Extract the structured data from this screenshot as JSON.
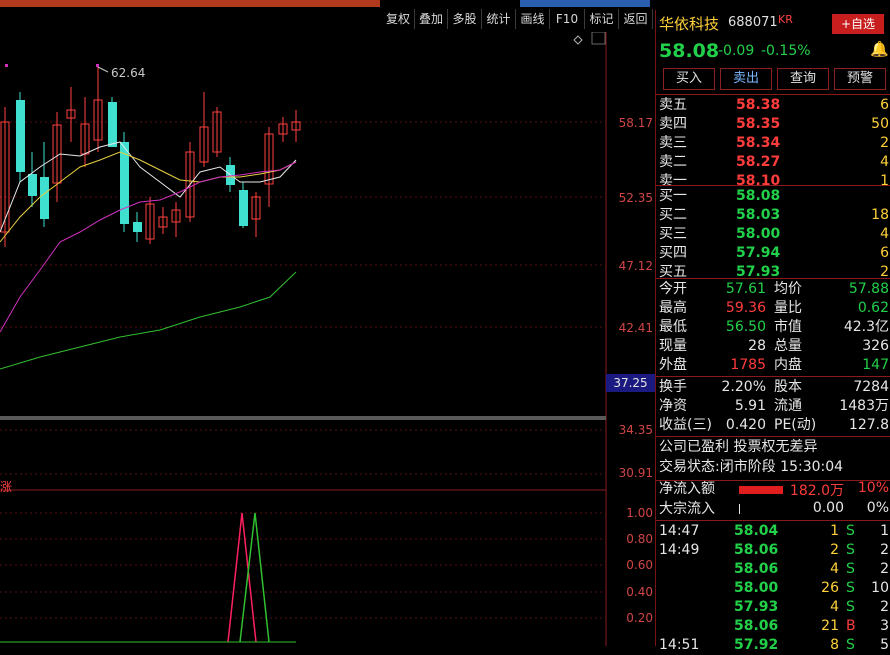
{
  "toolbar": {
    "buttons": [
      "复权",
      "叠加",
      "多股",
      "统计",
      "画线",
      "F10",
      "标记",
      "返回"
    ]
  },
  "chart": {
    "peak_label": "62.64",
    "price_axis": [
      "58.17",
      "52.35",
      "47.12",
      "42.41",
      "37.25",
      "34.35",
      "30.91"
    ],
    "indicator_axis": [
      "1.00",
      "0.80",
      "0.60",
      "0.40",
      "0.20"
    ],
    "indicator_label": "涨"
  },
  "stock": {
    "name": "华依科技",
    "code": "688071",
    "tag": "KR",
    "add_watch_label": "+自选",
    "price": "58.08",
    "change": "-0.09",
    "change_pct": "-0.15%"
  },
  "actions": {
    "buy": "买入",
    "sell": "卖出",
    "query": "查询",
    "alert": "预警"
  },
  "asks": [
    {
      "label": "卖五",
      "price": "58.38",
      "vol": "6",
      "pc": "red"
    },
    {
      "label": "卖四",
      "price": "58.35",
      "vol": "50",
      "pc": "red"
    },
    {
      "label": "卖三",
      "price": "58.34",
      "vol": "2",
      "pc": "red"
    },
    {
      "label": "卖二",
      "price": "58.27",
      "vol": "4",
      "pc": "red"
    },
    {
      "label": "卖一",
      "price": "58.10",
      "vol": "1",
      "pc": "red"
    }
  ],
  "bids": [
    {
      "label": "买一",
      "price": "58.08",
      "vol": "",
      "pc": "green"
    },
    {
      "label": "买二",
      "price": "58.03",
      "vol": "18",
      "pc": "green"
    },
    {
      "label": "买三",
      "price": "58.00",
      "vol": "4",
      "pc": "green"
    },
    {
      "label": "买四",
      "price": "57.94",
      "vol": "6",
      "pc": "green"
    },
    {
      "label": "买五",
      "price": "57.93",
      "vol": "2",
      "pc": "green"
    }
  ],
  "stats": [
    {
      "l1": "今开",
      "v1": "57.61",
      "c1": "green",
      "l2": "均价",
      "v2": "57.88",
      "c2": "green"
    },
    {
      "l1": "最高",
      "v1": "59.36",
      "c1": "red",
      "l2": "量比",
      "v2": "0.62",
      "c2": "green"
    },
    {
      "l1": "最低",
      "v1": "56.50",
      "c1": "green",
      "l2": "市值",
      "v2": "42.3亿",
      "c2": "white"
    },
    {
      "l1": "现量",
      "v1": "28",
      "c1": "white",
      "l2": "总量",
      "v2": "326",
      "c2": "white"
    },
    {
      "l1": "外盘",
      "v1": "1785",
      "c1": "red",
      "l2": "内盘",
      "v2": "147",
      "c2": "green"
    }
  ],
  "stats2": [
    {
      "l1": "换手",
      "v1": "2.20%",
      "l2": "股本",
      "v2": "7284"
    },
    {
      "l1": "净资",
      "v1": "5.91",
      "l2": "流通",
      "v2": "1483万"
    },
    {
      "l1": "收益(三)",
      "v1": "0.420",
      "l2": "PE(动)",
      "v2": "127.8"
    }
  ],
  "info": {
    "profit_line": "公司已盈利 投票权无差异",
    "status_label": "交易状态:",
    "status_value": "闭市阶段 15:30:04"
  },
  "flows": [
    {
      "label": "净流入额",
      "value": "182.0万",
      "pct": "10%"
    },
    {
      "label": "大宗流入",
      "value": "0.00",
      "pct": "0%"
    }
  ],
  "ticks": [
    {
      "time": "14:47",
      "price": "58.04",
      "vol": "1",
      "side": "S",
      "n": "1"
    },
    {
      "time": "14:49",
      "price": "58.06",
      "vol": "2",
      "side": "S",
      "n": "2"
    },
    {
      "time": "",
      "price": "58.06",
      "vol": "4",
      "side": "S",
      "n": "2"
    },
    {
      "time": "",
      "price": "58.00",
      "vol": "26",
      "side": "S",
      "n": "10"
    },
    {
      "time": "",
      "price": "57.93",
      "vol": "4",
      "side": "S",
      "n": "2"
    },
    {
      "time": "",
      "price": "58.06",
      "vol": "21",
      "side": "B",
      "n": "3"
    },
    {
      "time": "14:51",
      "price": "57.92",
      "vol": "8",
      "side": "S",
      "n": "5"
    }
  ]
}
